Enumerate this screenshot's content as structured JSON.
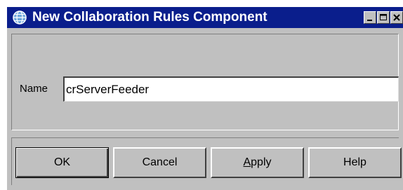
{
  "window": {
    "title": "New Collaboration Rules Component",
    "controls": {
      "minimize_icon": "minimize-icon",
      "maximize_icon": "maximize-icon",
      "close_icon": "close-icon"
    },
    "title_icon": "globe-icon",
    "colors": {
      "titlebar": "#0a1e8c",
      "face": "#c0c0c0"
    }
  },
  "form": {
    "name_label": "Name",
    "name_value": "crServerFeeder"
  },
  "buttons": {
    "ok": "OK",
    "cancel": "Cancel",
    "apply_mnemonic": "A",
    "apply_rest": "pply",
    "help": "Help"
  }
}
